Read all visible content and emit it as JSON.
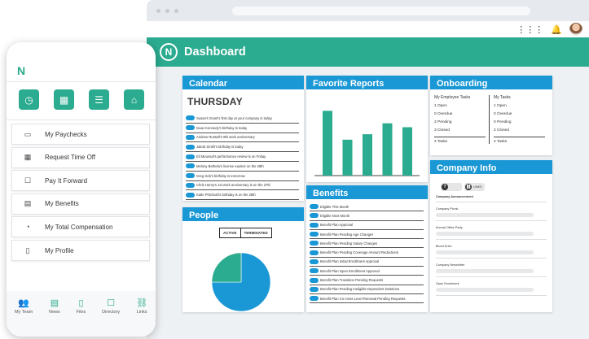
{
  "header": {
    "title": "Dashboard"
  },
  "calendar": {
    "title": "Calendar",
    "day": "THURSDAY",
    "events": [
      "Susan's Grant's first day at your company is today",
      "Isaac Kennedy's birthday is today",
      "Andrew Russell's 9th work anniversary",
      "Jakob Smith's birthday is today",
      "Eli Mounsal's performance review is on Friday",
      "Melony Bethela's license expires on the 28th",
      "Greg Sob's birthday is tomorrow",
      "Chris Henry's 1st work anniversary is on the 27th",
      "Katie Pritchard's birthday is on the 28th"
    ]
  },
  "favorite_reports": {
    "title": "Favorite Reports"
  },
  "chart_data": {
    "type": "bar",
    "values": [
      83,
      46,
      53,
      67,
      62
    ],
    "ylim": [
      0,
      100
    ],
    "color": "#2bab8f"
  },
  "onboarding": {
    "title": "Onboarding",
    "employee_tasks": {
      "heading": "My Employee Tasks",
      "rows": [
        "1 Open",
        "0 Overdue",
        "2 Pending",
        "3 Closed"
      ],
      "total": "4 Tasks"
    },
    "my_tasks": {
      "heading": "My Tasks",
      "rows": [
        "1 Open",
        "0 Overdue",
        "0 Pending",
        "2 Closed"
      ],
      "total": "4 Tasks"
    }
  },
  "company_info": {
    "title": "Company Info",
    "button1": "",
    "button2": "LINKS",
    "section": "Company Announcement",
    "items": [
      "Company Picnic",
      "Annual Office Party",
      "Blood Drive",
      "Company Newsletter",
      "Open Enrollment"
    ]
  },
  "benefits": {
    "title": "Benefits",
    "items": [
      "Eligible This Month",
      "Eligible Next Month",
      "Benefit Plan Approval",
      "Benefit Plan Pending Age Changes",
      "Benefit Plan Pending Salary Changes",
      "Benefit Plan Pending Coverage Amount Reductions",
      "Benefit Plan Initial Enrollment Approval",
      "Benefit Plan Open Enrollment Approval",
      "Benefit Plan Transition Pending Requests",
      "Benefit Plan Pending Ineligible Dependent Deletions",
      "Benefit Plan Co-cross Level Renewal Pending Requests"
    ]
  },
  "people": {
    "title": "People",
    "active_label": "ACTIVE",
    "terminated_label": "TERMINATED",
    "pie": {
      "active_fraction": 0.75,
      "terminated_fraction": 0.25,
      "active_color": "#1a98d5",
      "terminated_color": "#2bab8f"
    }
  },
  "phone": {
    "logo": "N",
    "tiles": [
      "clock-icon",
      "grid-icon",
      "list-icon",
      "bank-icon"
    ],
    "menu": [
      "My Paychecks",
      "Request Time Off",
      "Pay It Forward",
      "My Benefits",
      "My Total Compensation",
      "My Profile"
    ],
    "nav": [
      "My Team",
      "News",
      "Files",
      "Directory",
      "Links"
    ]
  },
  "colors": {
    "brand": "#2bab8f",
    "accent": "#1a98d5"
  }
}
